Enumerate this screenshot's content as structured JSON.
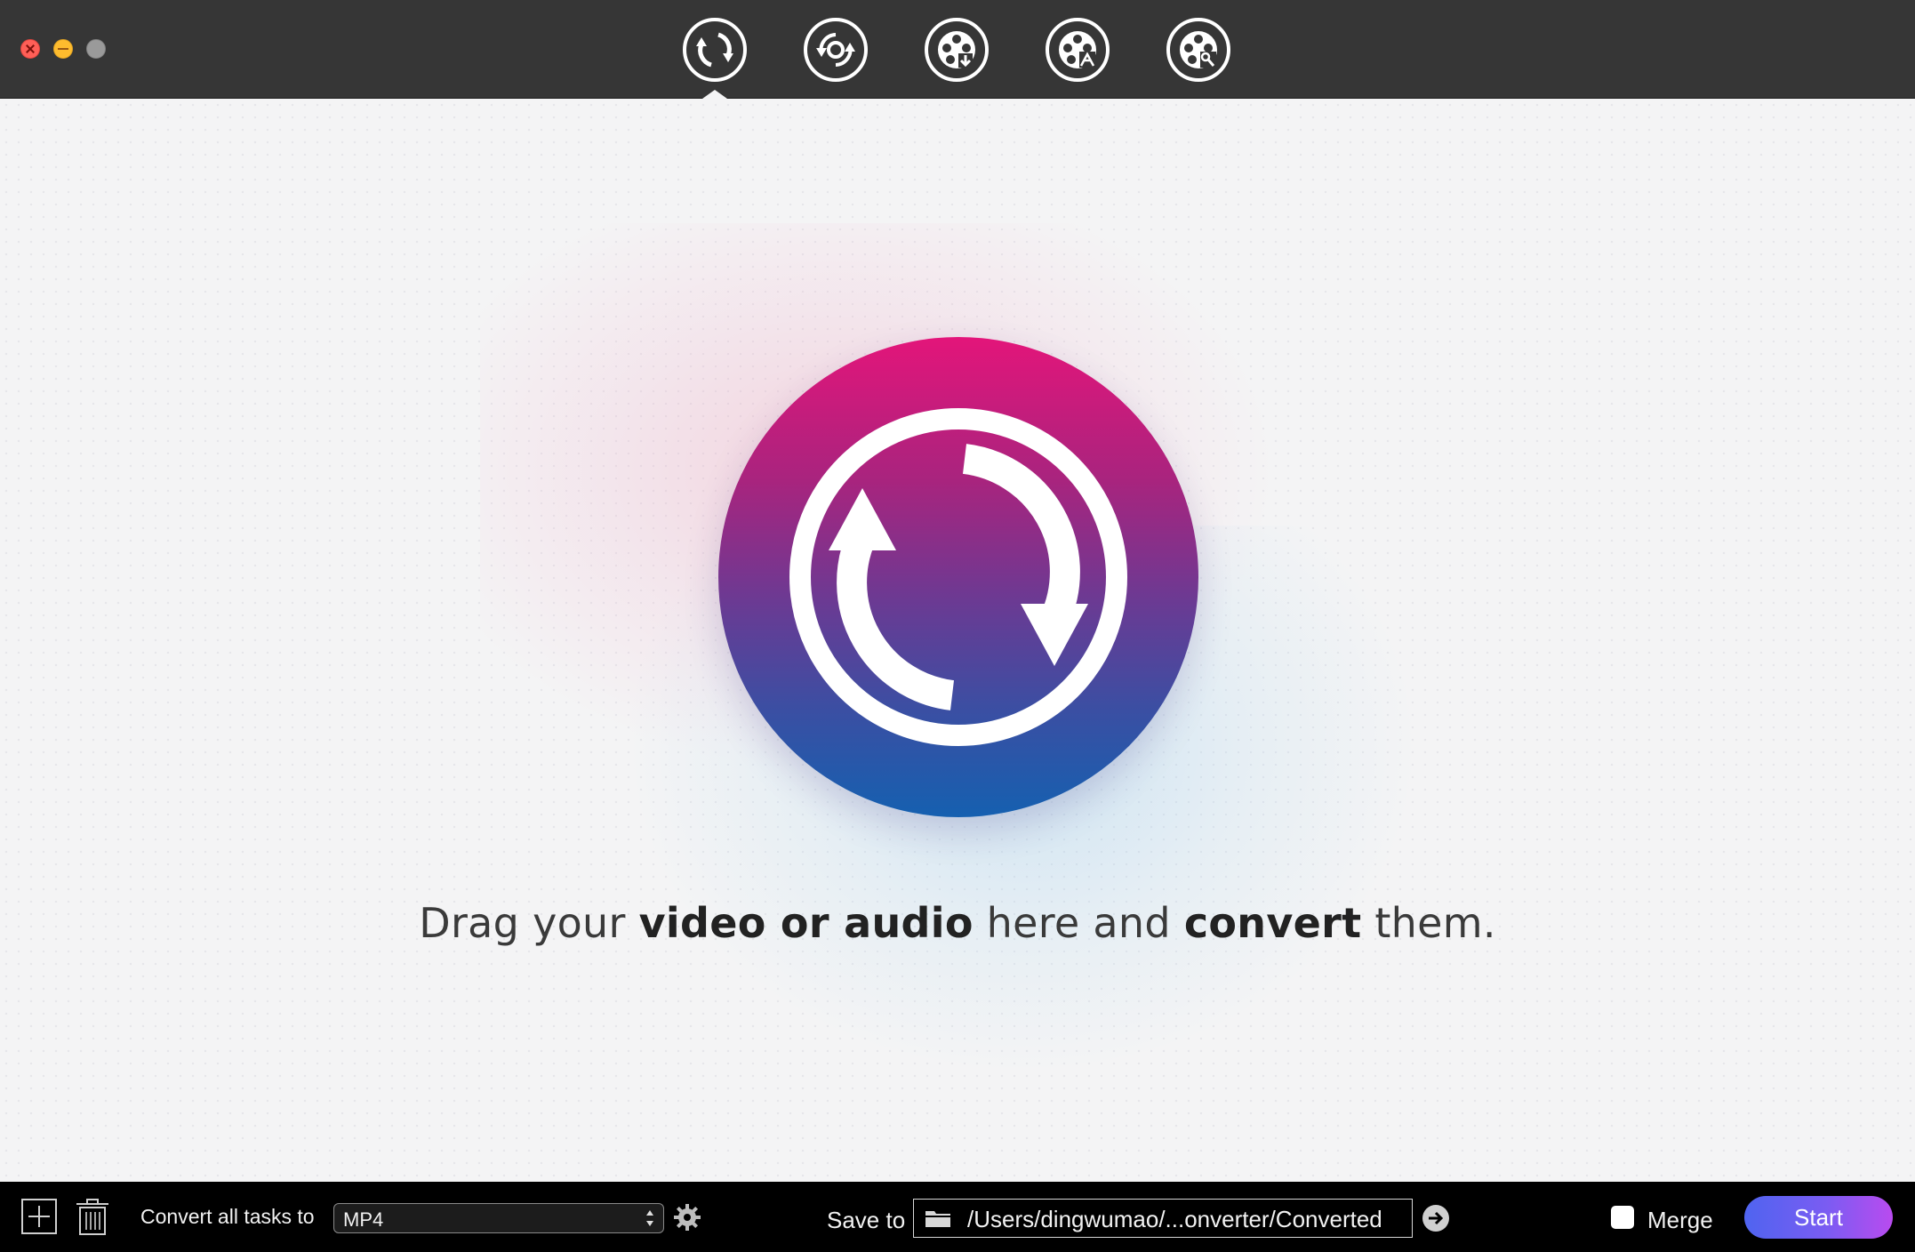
{
  "window": {
    "traffic_lights": [
      "close",
      "minimize",
      "zoom"
    ]
  },
  "toolbar": {
    "tools": [
      {
        "id": "convert",
        "icon": "convert-arrows-icon",
        "active": true
      },
      {
        "id": "dvd",
        "icon": "disc-rotate-icon",
        "active": false
      },
      {
        "id": "download",
        "icon": "film-reel-download-icon",
        "active": false
      },
      {
        "id": "record",
        "icon": "film-reel-record-icon",
        "active": false
      },
      {
        "id": "toolbox",
        "icon": "film-reel-wrench-icon",
        "active": false
      }
    ]
  },
  "main": {
    "hint": {
      "part1": "Drag your ",
      "bold1": "video or audio",
      "part2": " here and ",
      "bold2": "convert",
      "part3": " them."
    },
    "logo_colors": [
      "#e3157a",
      "#6b3a93",
      "#1560b0"
    ]
  },
  "bottom": {
    "convert_label": "Convert all tasks to",
    "format_value": "MP4",
    "save_label": "Save to",
    "save_path": "/Users/dingwumao/...onverter/Converted",
    "merge_label": "Merge",
    "merge_checked": false,
    "start_label": "Start",
    "start_gradient": [
      "#4f64f0",
      "#b94bef"
    ]
  }
}
